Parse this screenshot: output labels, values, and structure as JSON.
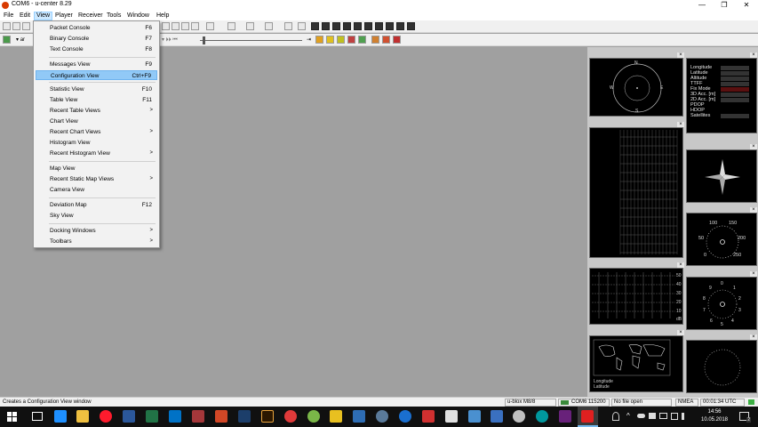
{
  "window": {
    "title": "COM6 - u-center 8.29",
    "minimize_glyph": "—",
    "maximize_glyph": "❐",
    "close_glyph": "✕"
  },
  "menubar": [
    {
      "label": "File"
    },
    {
      "label": "Edit"
    },
    {
      "label": "View"
    },
    {
      "label": "Player"
    },
    {
      "label": "Receiver"
    },
    {
      "label": "Tools"
    },
    {
      "label": "Window"
    },
    {
      "label": "Help"
    }
  ],
  "toolbar": {
    "combo_fragment": "ar"
  },
  "view_menu": {
    "items": [
      {
        "label": "Packet Console",
        "shortcut": "F6"
      },
      {
        "label": "Binary Console",
        "shortcut": "F7"
      },
      {
        "label": "Text Console",
        "shortcut": "F8"
      },
      {
        "label": "Messages View",
        "shortcut": "F9"
      },
      {
        "label": "Configuration View",
        "shortcut": "Ctrl+F9"
      },
      {
        "label": "Statistic View",
        "shortcut": "F10"
      },
      {
        "label": "Table View",
        "shortcut": "F11"
      },
      {
        "label": "Recent Table Views",
        "submenu": ">"
      },
      {
        "label": "Chart View"
      },
      {
        "label": "Recent Chart Views",
        "submenu": ">"
      },
      {
        "label": "Histogram View"
      },
      {
        "label": "Recent Histogram View",
        "submenu": ">"
      },
      {
        "label": "Map View"
      },
      {
        "label": "Recent Static Map Views",
        "submenu": ">"
      },
      {
        "label": "Camera View"
      },
      {
        "label": "Deviation Map",
        "shortcut": "F12"
      },
      {
        "label": "Sky View"
      },
      {
        "label": "Docking Windows",
        "submenu": ">"
      },
      {
        "label": "Toolbars",
        "submenu": ">"
      }
    ],
    "highlighted": "Configuration View"
  },
  "dock": {
    "compass": {
      "n": "N",
      "s": "S",
      "e": "E",
      "w": "W"
    },
    "info_labels": [
      "Longitude",
      "Latitude",
      "Altitude",
      "TTFF",
      "Fix Mode",
      "3D Acc. [m]",
      "2D Acc. [m]",
      "PDOP",
      "HDOP",
      "Satellites"
    ],
    "signal_scale": [
      "50",
      "40",
      "30",
      "20",
      "10",
      "dB"
    ],
    "speed_gauge": [
      "100",
      "150",
      "50",
      "200",
      "0",
      "250"
    ],
    "sat_gauge": [
      "0",
      "1",
      "2",
      "3",
      "4",
      "5",
      "6",
      "7",
      "8",
      "9"
    ],
    "map_labels": [
      "Longitude",
      "Latitude"
    ],
    "close_glyph": "×"
  },
  "statusbar": {
    "message": "Creates a Configuration View window",
    "receiver": "u-blox M8/8",
    "port": "COM6 115200",
    "file": "No file open",
    "protocol": "NMEA",
    "time": "00:01:34 UTC"
  },
  "taskbar": {
    "clock_time": "14:56",
    "clock_date": "10.05.2018",
    "notification_count": "2",
    "colors": {
      "edge": "#1e90ff",
      "explorer": "#f0c040",
      "opera": "#ff1b2d",
      "word": "#2b579a",
      "excel": "#217346",
      "outlook": "#0072c6",
      "access": "#a4373a",
      "powerpoint": "#d24726",
      "photoshop": "#1c3e6a",
      "bridge": "#2b1700",
      "ucenter": "#e02020"
    }
  }
}
